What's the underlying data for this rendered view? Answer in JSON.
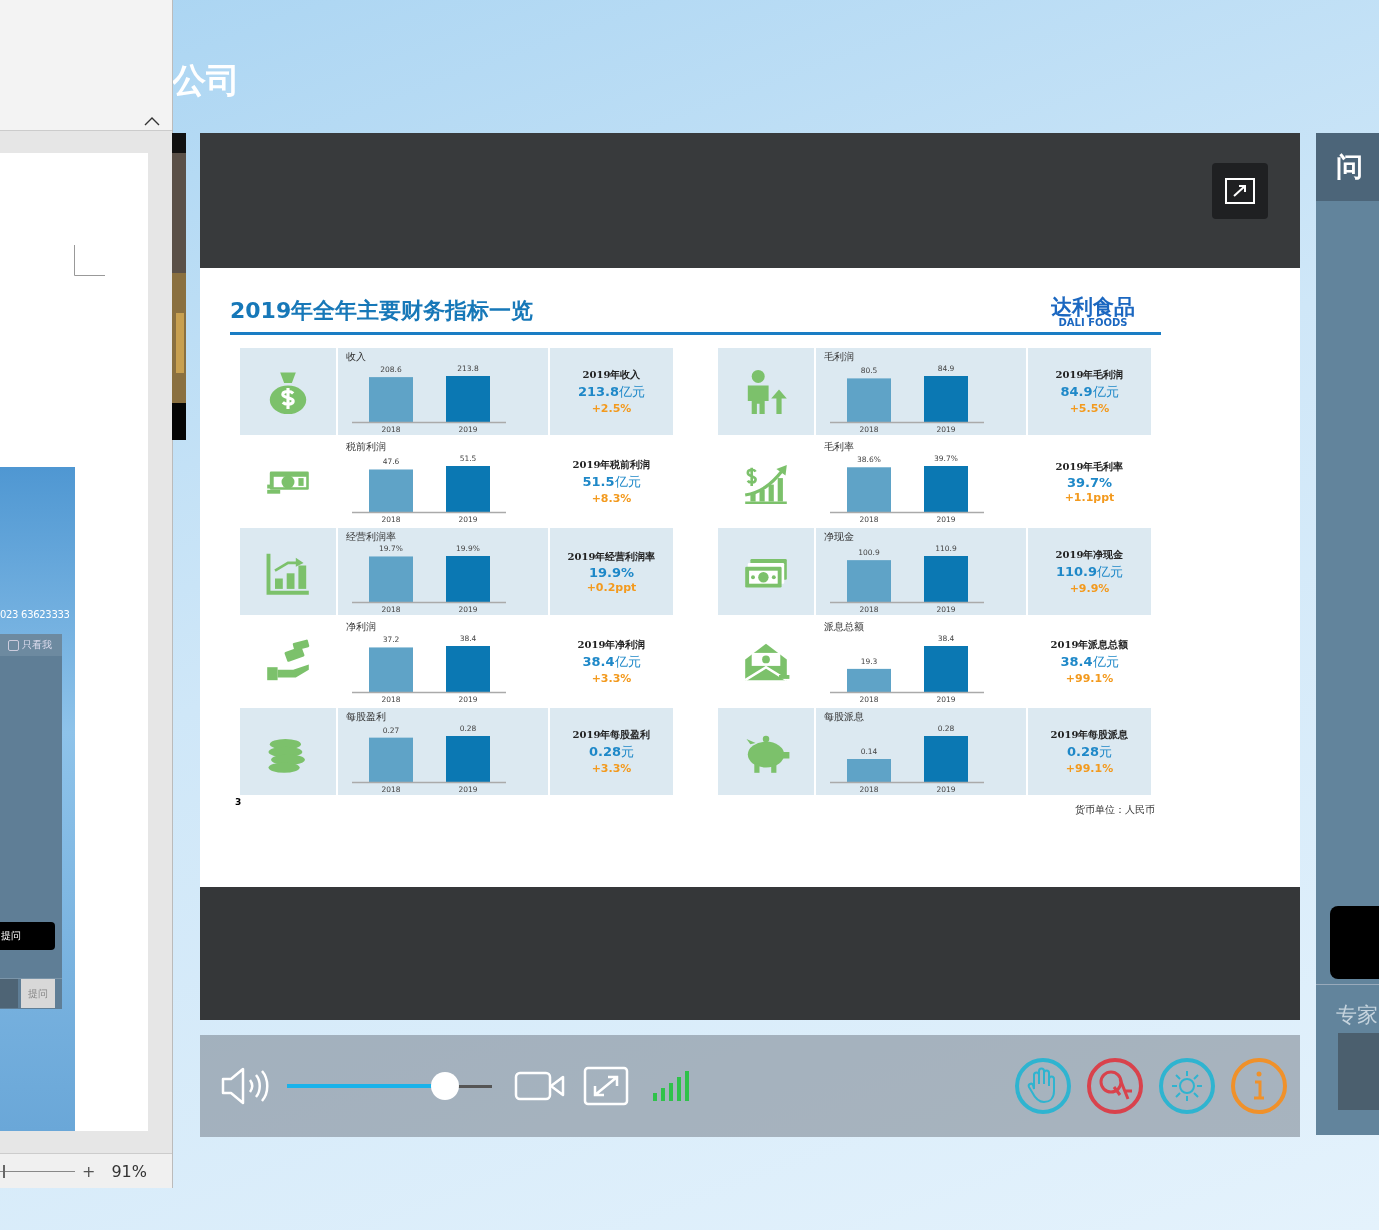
{
  "page_title_fragment": "公司",
  "document_window": {
    "phone": "023 63623333",
    "only_me": {
      "label": "只看我",
      "checked": false
    },
    "ask_button": "提问",
    "question_field": {
      "button": "提问"
    },
    "zoom_slider": {
      "level": 0.04
    },
    "zoom_in": "+",
    "zoom": "91%"
  },
  "slide": {
    "title": "2019年全年主要财务指标一览",
    "logo": {
      "name": "达利食品",
      "subtitle": "DALI FOODS"
    },
    "page_number": "3",
    "currency_note": "货币单位：人民币",
    "columns": [
      [
        {
          "summary_label": "2019年收入",
          "summary_value": "**213.8**亿元",
          "change": "+2.5%",
          "chart_data": {
            "type": "bar",
            "title": "收入",
            "categories": [
              "2018",
              "2019"
            ],
            "values": [
              208.6,
              213.8
            ],
            "data_labels": true,
            "value_labels": [
              "208.6",
              "213.8"
            ]
          }
        },
        {
          "summary_label": "2019年税前利润",
          "summary_value": "**51.5**亿元",
          "change": "+8.3%",
          "chart_data": {
            "type": "bar",
            "title": "税前利润",
            "categories": [
              "2018",
              "2019"
            ],
            "values": [
              47.6,
              51.5
            ],
            "data_labels": true,
            "value_labels": [
              "47.6",
              "51.5"
            ]
          }
        },
        {
          "summary_label": "2019年经营利润率",
          "summary_value": "**19.9%**",
          "change": "+0.2ppt",
          "chart_data": {
            "type": "bar",
            "title": "经营利润率",
            "categories": [
              "2018",
              "2019"
            ],
            "values": [
              19.7,
              19.9
            ],
            "data_labels": true,
            "value_labels": [
              "19.7%",
              "19.9%"
            ]
          }
        },
        {
          "summary_label": "2019年净利润",
          "summary_value": "**38.4**亿元",
          "change": "+3.3%",
          "chart_data": {
            "type": "bar",
            "title": "净利润",
            "categories": [
              "2018",
              "2019"
            ],
            "values": [
              37.2,
              38.4
            ],
            "data_labels": true,
            "value_labels": [
              "37.2",
              "38.4"
            ]
          }
        },
        {
          "summary_label": "2019年每股盈利",
          "summary_value": "**0.28**元",
          "change": "+3.3%",
          "chart_data": {
            "type": "bar",
            "title": "每股盈利",
            "categories": [
              "2018",
              "2019"
            ],
            "values": [
              0.27,
              0.28
            ],
            "data_labels": true,
            "value_labels": [
              "0.27",
              "0.28"
            ]
          }
        }
      ],
      [
        {
          "summary_label": "2019年毛利润",
          "summary_value": "**84.9**亿元",
          "change": "+5.5%",
          "chart_data": {
            "type": "bar",
            "title": "毛利润",
            "categories": [
              "2018",
              "2019"
            ],
            "values": [
              80.5,
              84.9
            ],
            "data_labels": true,
            "value_labels": [
              "80.5",
              "84.9"
            ]
          }
        },
        {
          "summary_label": "2019年毛利率",
          "summary_value": "**39.7%**",
          "change": "+1.1ppt",
          "chart_data": {
            "type": "bar",
            "title": "毛利率",
            "categories": [
              "2018",
              "2019"
            ],
            "values": [
              38.6,
              39.7
            ],
            "data_labels": true,
            "value_labels": [
              "38.6%",
              "39.7%"
            ]
          }
        },
        {
          "summary_label": "2019年净现金",
          "summary_value": "**110.9**亿元",
          "change": "+9.9%",
          "chart_data": {
            "type": "bar",
            "title": "净现金",
            "categories": [
              "2018",
              "2019"
            ],
            "values": [
              100.9,
              110.9
            ],
            "data_labels": true,
            "value_labels": [
              "100.9",
              "110.9"
            ]
          }
        },
        {
          "summary_label": "2019年派息总额",
          "summary_value": "**38.4**亿元",
          "change": "+99.1%",
          "chart_data": {
            "type": "bar",
            "title": "派息总额",
            "categories": [
              "2018",
              "2019"
            ],
            "values": [
              19.3,
              38.4
            ],
            "data_labels": true,
            "value_labels": [
              "19.3",
              "38.4"
            ]
          }
        },
        {
          "summary_label": "2019年每股派息",
          "summary_value": "**0.28**元",
          "change": "+99.1%",
          "chart_data": {
            "type": "bar",
            "title": "每股派息",
            "categories": [
              "2018",
              "2019"
            ],
            "values": [
              0.14,
              0.28
            ],
            "data_labels": true,
            "value_labels": [
              "0.14",
              "0.28"
            ]
          }
        }
      ]
    ]
  },
  "controls": {
    "volume": {
      "level": 0.77
    }
  },
  "qa_panel": {
    "title": "问",
    "experts_label": "专家"
  }
}
